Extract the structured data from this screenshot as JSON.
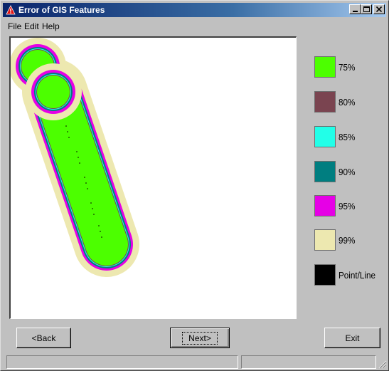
{
  "window": {
    "title": "Error of GIS Features"
  },
  "menu": {
    "file": "File",
    "edit": "Edit",
    "help": "Help"
  },
  "legend": {
    "items": [
      {
        "label": "75%",
        "color": "#4cff00"
      },
      {
        "label": "80%",
        "color": "#7a4450"
      },
      {
        "label": "85%",
        "color": "#22ffe8"
      },
      {
        "label": "90%",
        "color": "#007e80"
      },
      {
        "label": "95%",
        "color": "#e600e6"
      },
      {
        "label": "99%",
        "color": "#ede8b0"
      },
      {
        "label": "Point/Line",
        "color": "#000000"
      }
    ]
  },
  "buttons": {
    "back": "<Back",
    "next": "Next>",
    "exit": "Exit"
  }
}
